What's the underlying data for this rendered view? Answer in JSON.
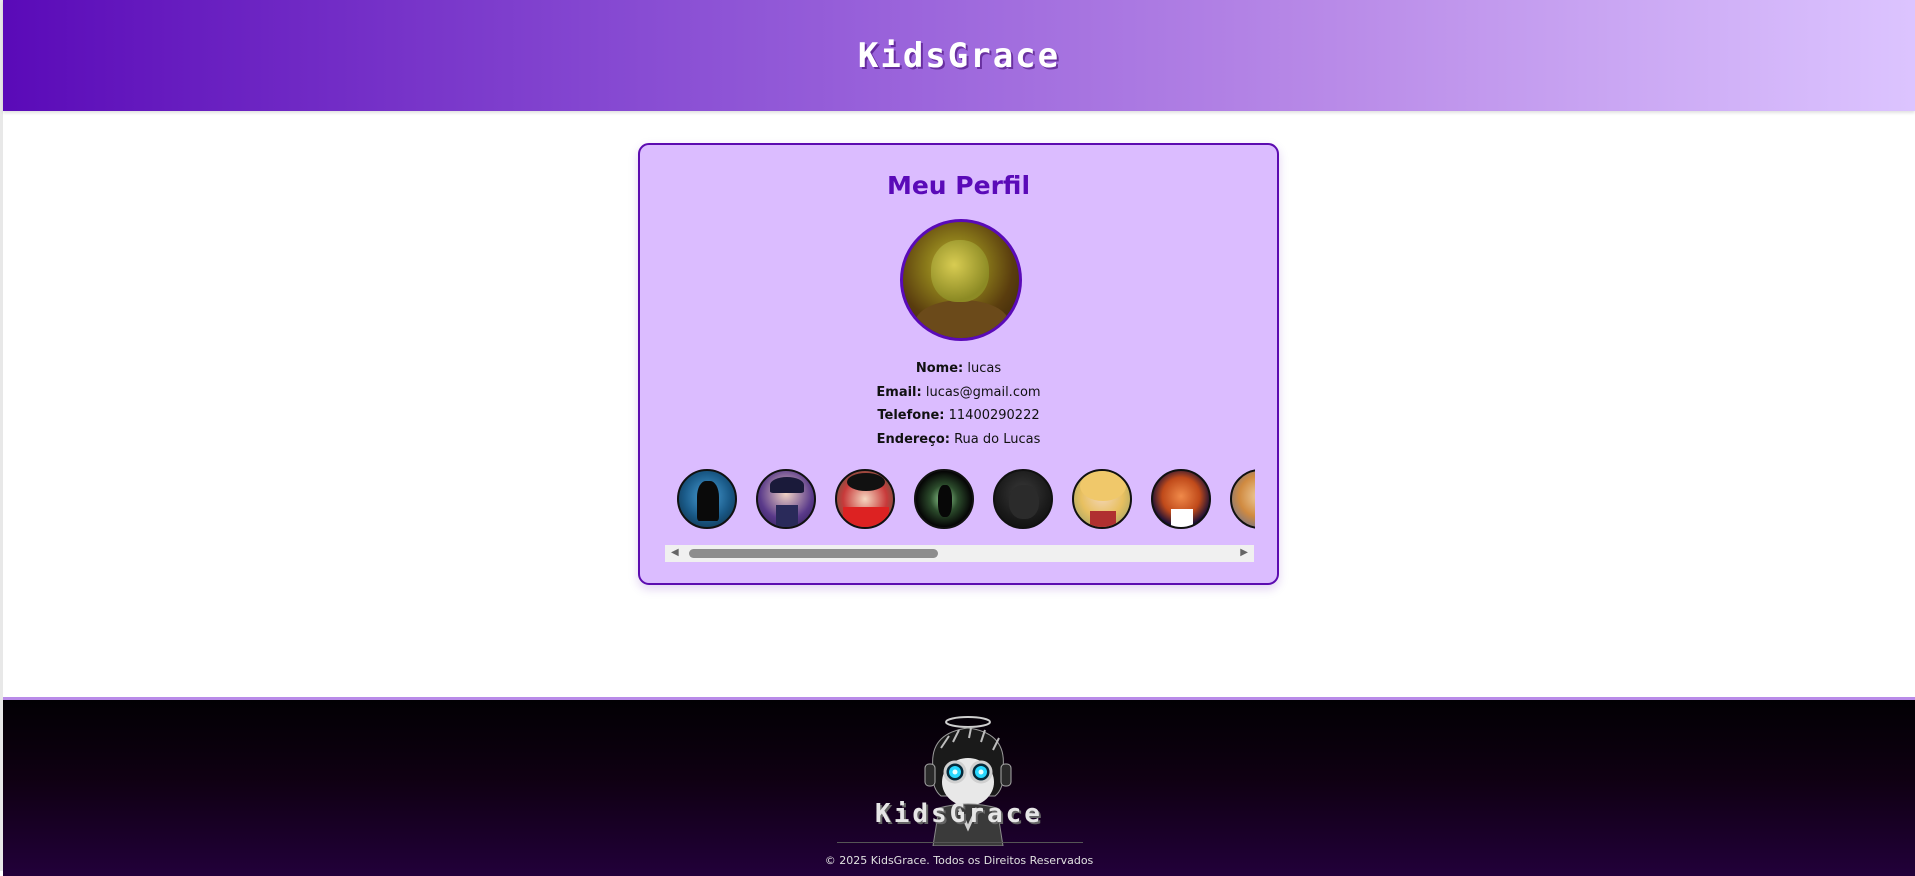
{
  "header": {
    "brand": "KidsGrace"
  },
  "profile": {
    "title": "Meu Perfil",
    "fields": [
      {
        "label": "Nome:",
        "value": "lucas"
      },
      {
        "label": "Email:",
        "value": "lucas@gmail.com"
      },
      {
        "label": "Telefone:",
        "value": "11400290222"
      },
      {
        "label": "Endereço:",
        "value": "Rua do Lucas"
      }
    ],
    "gallery_count_visible": 8
  },
  "footer": {
    "brand": "KidsGrace",
    "copyright": "© 2025 KidsGrace. Todos os Direitos Reservados"
  },
  "colors": {
    "brand_purple": "#5a0ab8",
    "card_bg": "#dbbcff",
    "footer_dark": "#0f0012"
  },
  "icons": {
    "scroll_left": "triangle-left-icon",
    "scroll_right": "triangle-right-icon"
  }
}
